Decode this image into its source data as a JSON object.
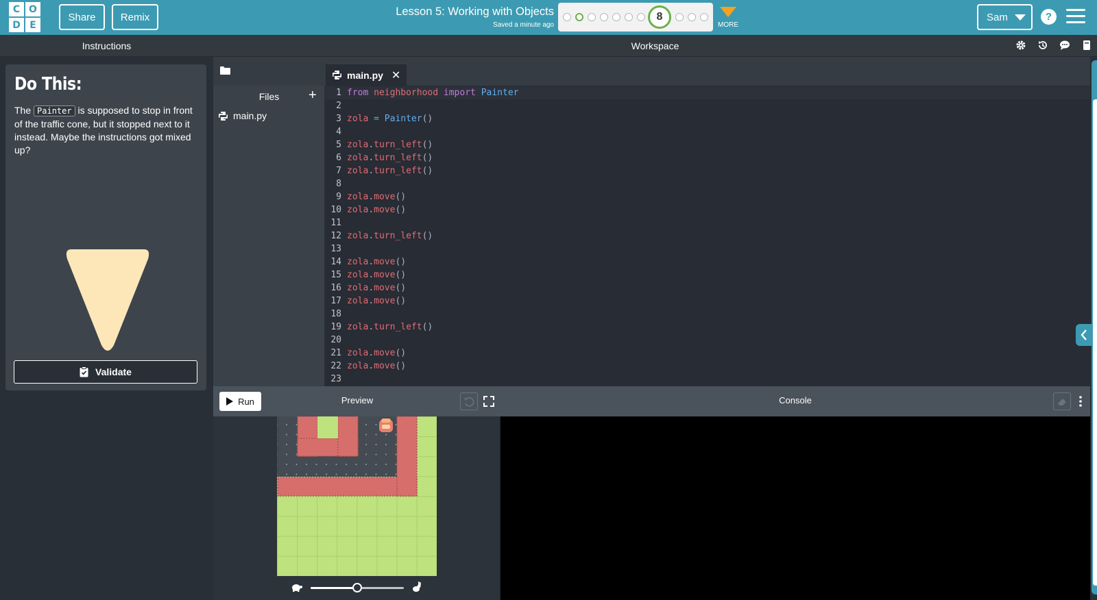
{
  "header": {
    "logo_letters": [
      "C",
      "O",
      "D",
      "E"
    ],
    "share_label": "Share",
    "remix_label": "Remix",
    "lesson_title": "Lesson 5: Working with Objects",
    "saved_status": "Saved a minute ago",
    "progress": {
      "current_level": "8"
    },
    "more_label": "MORE",
    "user_name": "Sam",
    "help_label": "?"
  },
  "instructions": {
    "panel_title": "Instructions",
    "heading": "Do This:",
    "text_before": "The ",
    "code_word": "Painter",
    "text_after": " is supposed to stop in front of the traffic cone, but it stopped next to it instead. Maybe the instructions got mixed up?",
    "validate_label": "Validate"
  },
  "workspace": {
    "title": "Workspace",
    "files_label": "Files",
    "add_label": "+",
    "file_name": "main.py",
    "tab_name": "main.py",
    "close_label": "✕"
  },
  "code_lines": [
    "from neighborhood import Painter",
    "",
    "zola = Painter()",
    "",
    "zola.turn_left()",
    "zola.turn_left()",
    "zola.turn_left()",
    "",
    "zola.move()",
    "zola.move()",
    "",
    "zola.turn_left()",
    "",
    "zola.move()",
    "zola.move()",
    "zola.move()",
    "zola.move()",
    "",
    "zola.turn_left()",
    "",
    "zola.move()",
    "zola.move()",
    ""
  ],
  "preview": {
    "run_label": "Run",
    "title": "Preview",
    "speed": 0.5
  },
  "console": {
    "title": "Console"
  },
  "colors": {
    "brand": "#3c9bb2",
    "progress_done": "#6ab14a",
    "more_arrow": "#f8a21d",
    "cone": "#fde7b9"
  }
}
